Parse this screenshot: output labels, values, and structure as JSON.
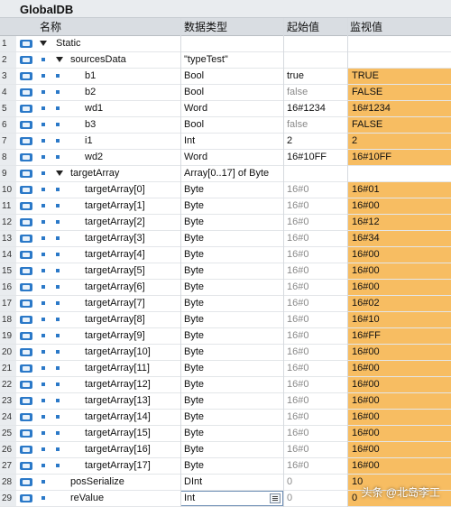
{
  "window": {
    "title": "GlobalDB"
  },
  "columns": {
    "name": "名称",
    "type": "数据类型",
    "start": "起始值",
    "monitor": "监视值"
  },
  "colors": {
    "highlight": "#f7bd62",
    "icon": "#2b79c8"
  },
  "rows": [
    {
      "num": "1",
      "name": "Static",
      "type": "",
      "start": "",
      "monitor": ""
    },
    {
      "num": "2",
      "name": "sourcesData",
      "type": "\"typeTest\"",
      "start": "",
      "monitor": ""
    },
    {
      "num": "3",
      "name": "b1",
      "type": "Bool",
      "start": "true",
      "monitor": "TRUE"
    },
    {
      "num": "4",
      "name": "b2",
      "type": "Bool",
      "start": "false",
      "monitor": "FALSE"
    },
    {
      "num": "5",
      "name": "wd1",
      "type": "Word",
      "start": "16#1234",
      "monitor": "16#1234"
    },
    {
      "num": "6",
      "name": "b3",
      "type": "Bool",
      "start": "false",
      "monitor": "FALSE"
    },
    {
      "num": "7",
      "name": "i1",
      "type": "Int",
      "start": "2",
      "monitor": "2"
    },
    {
      "num": "8",
      "name": "wd2",
      "type": "Word",
      "start": "16#10FF",
      "monitor": "16#10FF"
    },
    {
      "num": "9",
      "name": "targetArray",
      "type": "Array[0..17] of Byte",
      "start": "",
      "monitor": ""
    },
    {
      "num": "10",
      "name": "targetArray[0]",
      "type": "Byte",
      "start": "16#0",
      "monitor": "16#01"
    },
    {
      "num": "11",
      "name": "targetArray[1]",
      "type": "Byte",
      "start": "16#0",
      "monitor": "16#00"
    },
    {
      "num": "12",
      "name": "targetArray[2]",
      "type": "Byte",
      "start": "16#0",
      "monitor": "16#12"
    },
    {
      "num": "13",
      "name": "targetArray[3]",
      "type": "Byte",
      "start": "16#0",
      "monitor": "16#34"
    },
    {
      "num": "14",
      "name": "targetArray[4]",
      "type": "Byte",
      "start": "16#0",
      "monitor": "16#00"
    },
    {
      "num": "15",
      "name": "targetArray[5]",
      "type": "Byte",
      "start": "16#0",
      "monitor": "16#00"
    },
    {
      "num": "16",
      "name": "targetArray[6]",
      "type": "Byte",
      "start": "16#0",
      "monitor": "16#00"
    },
    {
      "num": "17",
      "name": "targetArray[7]",
      "type": "Byte",
      "start": "16#0",
      "monitor": "16#02"
    },
    {
      "num": "18",
      "name": "targetArray[8]",
      "type": "Byte",
      "start": "16#0",
      "monitor": "16#10"
    },
    {
      "num": "19",
      "name": "targetArray[9]",
      "type": "Byte",
      "start": "16#0",
      "monitor": "16#FF"
    },
    {
      "num": "20",
      "name": "targetArray[10]",
      "type": "Byte",
      "start": "16#0",
      "monitor": "16#00"
    },
    {
      "num": "21",
      "name": "targetArray[11]",
      "type": "Byte",
      "start": "16#0",
      "monitor": "16#00"
    },
    {
      "num": "22",
      "name": "targetArray[12]",
      "type": "Byte",
      "start": "16#0",
      "monitor": "16#00"
    },
    {
      "num": "23",
      "name": "targetArray[13]",
      "type": "Byte",
      "start": "16#0",
      "monitor": "16#00"
    },
    {
      "num": "24",
      "name": "targetArray[14]",
      "type": "Byte",
      "start": "16#0",
      "monitor": "16#00"
    },
    {
      "num": "25",
      "name": "targetArray[15]",
      "type": "Byte",
      "start": "16#0",
      "monitor": "16#00"
    },
    {
      "num": "26",
      "name": "targetArray[16]",
      "type": "Byte",
      "start": "16#0",
      "monitor": "16#00"
    },
    {
      "num": "27",
      "name": "targetArray[17]",
      "type": "Byte",
      "start": "16#0",
      "monitor": "16#00"
    },
    {
      "num": "28",
      "name": "posSerialize",
      "type": "DInt",
      "start": "0",
      "monitor": "10"
    },
    {
      "num": "29",
      "name": "reValue",
      "type": "Int",
      "start": "0",
      "monitor": "0"
    }
  ],
  "watermark": "头条 @北岛李工"
}
